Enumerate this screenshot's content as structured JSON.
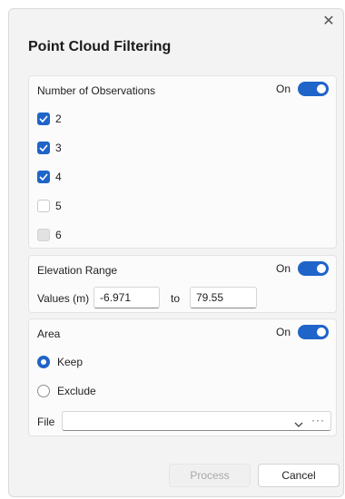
{
  "dialog": {
    "title": "Point Cloud Filtering",
    "close_icon": "close-icon"
  },
  "observations": {
    "label": "Number of Observations",
    "toggle_label": "On",
    "toggle_on": true,
    "items": [
      {
        "label": "2",
        "state": "checked"
      },
      {
        "label": "3",
        "state": "checked"
      },
      {
        "label": "4",
        "state": "checked"
      },
      {
        "label": "5",
        "state": "unchecked"
      },
      {
        "label": "6",
        "state": "disabled"
      }
    ]
  },
  "elevation": {
    "label": "Elevation Range",
    "toggle_label": "On",
    "toggle_on": true,
    "values_label": "Values (m)",
    "min_value": "-6.971",
    "to_label": "to",
    "max_value": "79.55"
  },
  "area": {
    "label": "Area",
    "toggle_label": "On",
    "toggle_on": true,
    "keep_label": "Keep",
    "exclude_label": "Exclude",
    "selected": "Keep",
    "file_label": "File",
    "file_value": "",
    "browse_icon": "ellipsis-icon"
  },
  "actions": {
    "process_label": "Process",
    "cancel_label": "Cancel"
  },
  "colors": {
    "accent": "#1f64c8",
    "dialog_bg": "#f3f3f3",
    "panel_bg": "#fbfbfb"
  }
}
